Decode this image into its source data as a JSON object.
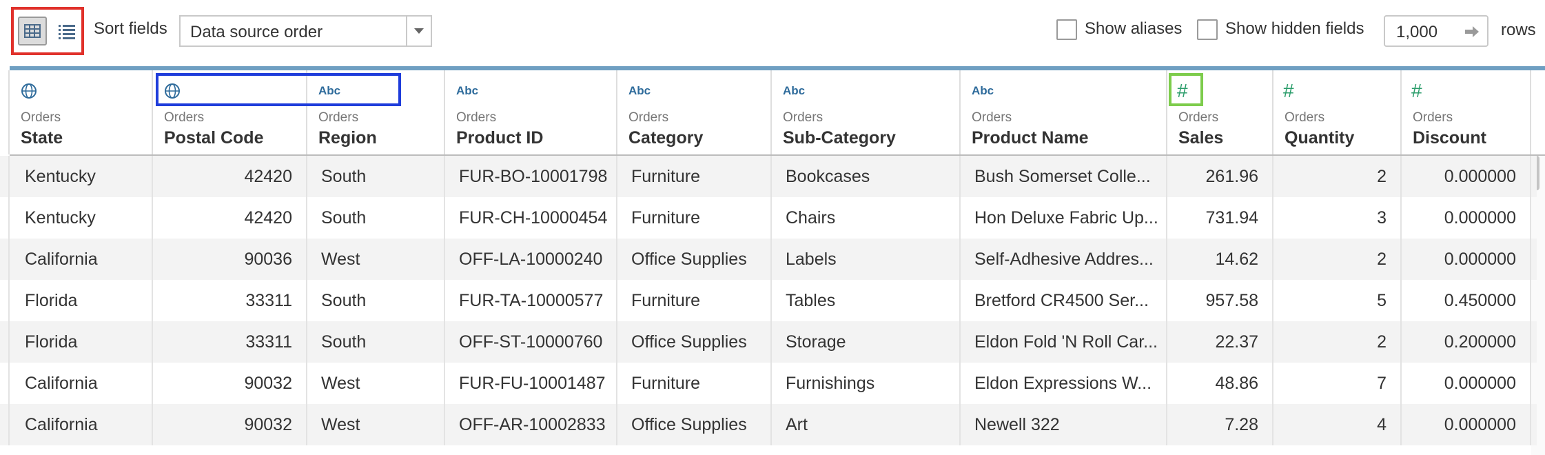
{
  "toolbar": {
    "sort_label": "Sort fields",
    "sort_value": "Data source order",
    "show_aliases_label": "Show aliases",
    "show_hidden_label": "Show hidden fields",
    "rows_value": "1,000",
    "rows_label": "rows"
  },
  "columns": [
    {
      "type_icon": "globe-icon",
      "source": "Orders",
      "name": "State"
    },
    {
      "type_icon": "globe-icon",
      "source": "Orders",
      "name": "Postal Code"
    },
    {
      "type_icon": "Abc",
      "source": "Orders",
      "name": "Region"
    },
    {
      "type_icon": "Abc",
      "source": "Orders",
      "name": "Product ID"
    },
    {
      "type_icon": "Abc",
      "source": "Orders",
      "name": "Category"
    },
    {
      "type_icon": "Abc",
      "source": "Orders",
      "name": "Sub-Category"
    },
    {
      "type_icon": "Abc",
      "source": "Orders",
      "name": "Product Name"
    },
    {
      "type_icon": "#",
      "source": "Orders",
      "name": "Sales"
    },
    {
      "type_icon": "#",
      "source": "Orders",
      "name": "Quantity"
    },
    {
      "type_icon": "#",
      "source": "Orders",
      "name": "Discount"
    }
  ],
  "rows": [
    [
      "Kentucky",
      "42420",
      "South",
      "FUR-BO-10001798",
      "Furniture",
      "Bookcases",
      "Bush Somerset Colle...",
      "261.96",
      "2",
      "0.000000"
    ],
    [
      "Kentucky",
      "42420",
      "South",
      "FUR-CH-10000454",
      "Furniture",
      "Chairs",
      "Hon Deluxe Fabric Up...",
      "731.94",
      "3",
      "0.000000"
    ],
    [
      "California",
      "90036",
      "West",
      "OFF-LA-10000240",
      "Office Supplies",
      "Labels",
      "Self-Adhesive Addres...",
      "14.62",
      "2",
      "0.000000"
    ],
    [
      "Florida",
      "33311",
      "South",
      "FUR-TA-10000577",
      "Furniture",
      "Tables",
      "Bretford CR4500 Ser...",
      "957.58",
      "5",
      "0.450000"
    ],
    [
      "Florida",
      "33311",
      "South",
      "OFF-ST-10000760",
      "Office Supplies",
      "Storage",
      "Eldon Fold 'N Roll Car...",
      "22.37",
      "2",
      "0.200000"
    ],
    [
      "California",
      "90032",
      "West",
      "FUR-FU-10001487",
      "Furniture",
      "Furnishings",
      "Eldon Expressions W...",
      "48.86",
      "7",
      "0.000000"
    ],
    [
      "California",
      "90032",
      "West",
      "OFF-AR-10002833",
      "Office Supplies",
      "Art",
      "Newell 322",
      "7.28",
      "4",
      "0.000000"
    ]
  ],
  "colors": {
    "highlight_red": "#e0312b",
    "highlight_blue": "#1f3ddb",
    "highlight_green": "#7dcc4c",
    "string_icon": "#2e6b9b",
    "number_icon": "#2b9d6b"
  }
}
